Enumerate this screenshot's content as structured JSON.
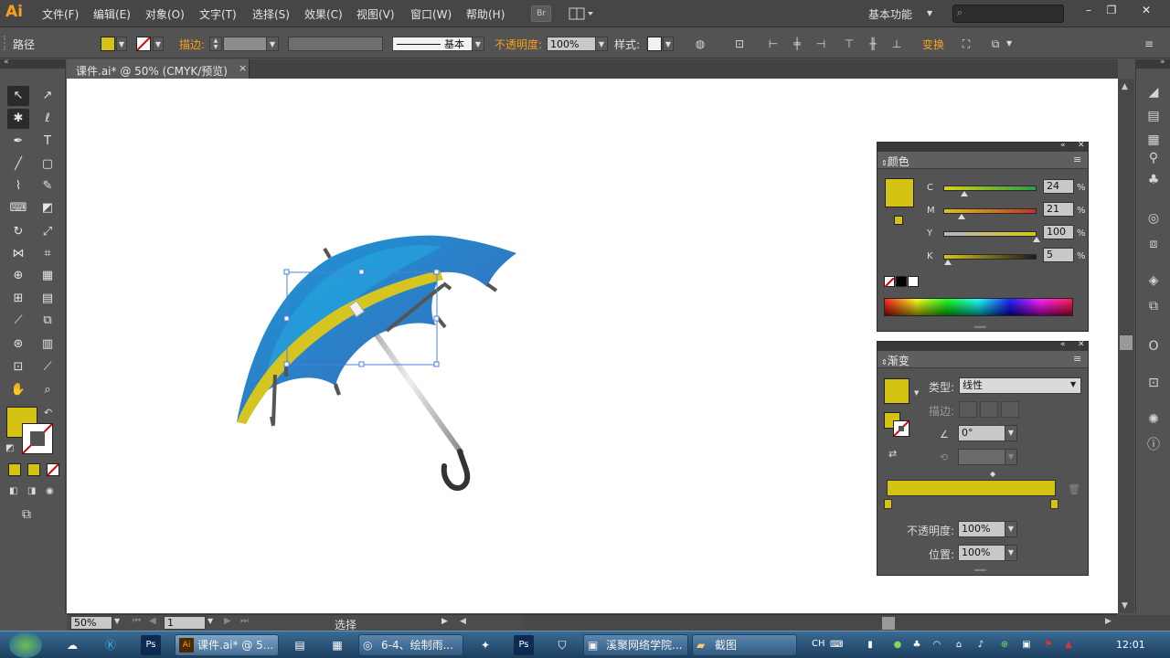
{
  "app": {
    "logo": "Ai"
  },
  "menu": [
    "文件(F)",
    "编辑(E)",
    "对象(O)",
    "文字(T)",
    "选择(S)",
    "效果(C)",
    "视图(V)",
    "窗口(W)",
    "帮助(H)"
  ],
  "bridge_label": "Br",
  "workspace_label": "基本功能",
  "control": {
    "selection_type": "路径",
    "stroke_label": "描边:",
    "stroke_profile": "基本",
    "opacity_label": "不透明度:",
    "opacity_value": "100%",
    "style_label": "样式:",
    "transform_label": "变换"
  },
  "document": {
    "tab_title": "课件.ai* @ 50% (CMYK/预览)",
    "close": "×"
  },
  "colors": {
    "fill": "#d5c313",
    "umbrella_blue": "#2b8bd0",
    "umbrella_stripe": "#d6c520",
    "accent_orange": "#f7a01d"
  },
  "color_panel": {
    "title": "颜色",
    "channels": [
      {
        "name": "C",
        "value": "24",
        "pct": "%"
      },
      {
        "name": "M",
        "value": "21",
        "pct": "%"
      },
      {
        "name": "Y",
        "value": "100",
        "pct": "%"
      },
      {
        "name": "K",
        "value": "5",
        "pct": "%"
      }
    ]
  },
  "gradient_panel": {
    "title": "渐变",
    "type_label": "类型:",
    "type_value": "线性",
    "stroke_label": "描边:",
    "angle_value": "0°",
    "opacity_label": "不透明度:",
    "opacity_value": "100%",
    "position_label": "位置:",
    "position_value": "100%"
  },
  "status": {
    "zoom": "50%",
    "artboard": "1",
    "tool": "选择"
  },
  "taskbar": {
    "items": [
      "课件.ai* @ 5...",
      "6-4、绘制雨...",
      "溪聚网络学院...",
      "截图"
    ],
    "lang": "CH",
    "clock": "12:01"
  }
}
